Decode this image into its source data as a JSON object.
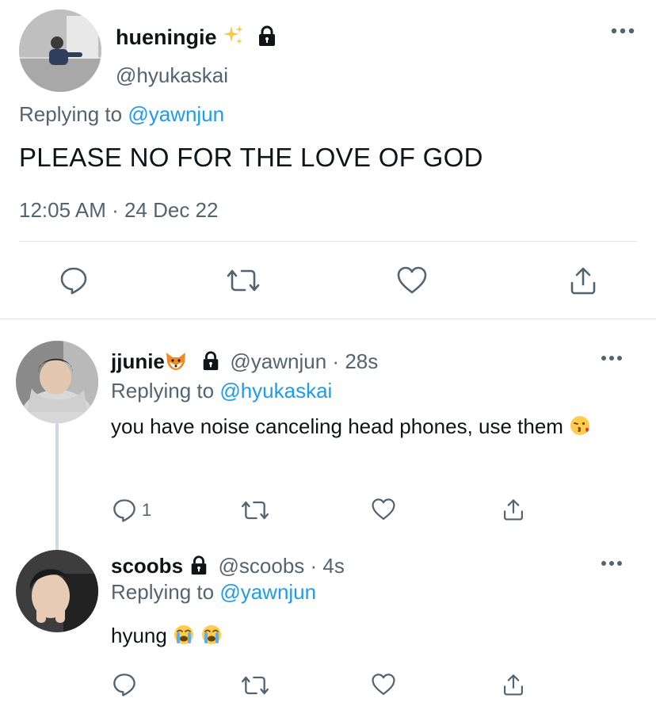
{
  "main_tweet": {
    "display_name": "hueningie",
    "name_emoji": "sparkles-icon",
    "handle": "@hyukaskai",
    "replying_prefix": "Replying to",
    "replying_to": "@yawnjun",
    "text": "PLEASE NO FOR THE LOVE OF GOD",
    "timestamp": "12:05 AM · 24 Dec 22",
    "actions": [
      "reply-icon",
      "retweet-icon",
      "like-icon",
      "share-icon"
    ]
  },
  "replies": [
    {
      "display_name": "jjunie",
      "name_emoji": "fox-icon",
      "handle": "@yawnjun",
      "time": "28s",
      "replying_prefix": "Replying to",
      "replying_to": "@hyukaskai",
      "text": "you have noise canceling head phones, use them",
      "text_emoji": "kissing-face-icon",
      "reply_count": "1"
    },
    {
      "display_name": "scoobs",
      "handle": "@scoobs",
      "time": "4s",
      "replying_prefix": "Replying to",
      "replying_to": "@yawnjun",
      "text": "hyung",
      "text_emoji": "crying-face-icon"
    }
  ],
  "colors": {
    "link": "#1d9bf0",
    "secondary_text": "#536471",
    "primary_text": "#0f1419",
    "divider": "#dfe3e6"
  }
}
